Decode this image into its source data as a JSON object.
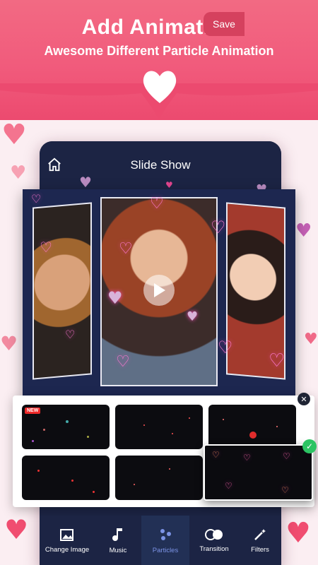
{
  "header": {
    "title": "Add Animation",
    "subtitle": "Awesome Different Particle Animation"
  },
  "screen": {
    "title": "Slide Show",
    "save_label": "Save"
  },
  "particle_panel": {
    "new_badge": "NEW",
    "selected_index": 6
  },
  "toolbar": {
    "items": [
      {
        "label": "Change Image",
        "icon": "image-icon"
      },
      {
        "label": "Music",
        "icon": "music-note-icon"
      },
      {
        "label": "Particles",
        "icon": "particles-icon",
        "active": true
      },
      {
        "label": "Transition",
        "icon": "transition-icon"
      },
      {
        "label": "Filters",
        "icon": "magic-wand-icon"
      }
    ]
  },
  "colors": {
    "brand_pink": "#f26a83",
    "save_button": "#d5415e",
    "panel_dark": "#1c2444",
    "active_tool": "#7c93e6",
    "check_green": "#2cc463"
  }
}
